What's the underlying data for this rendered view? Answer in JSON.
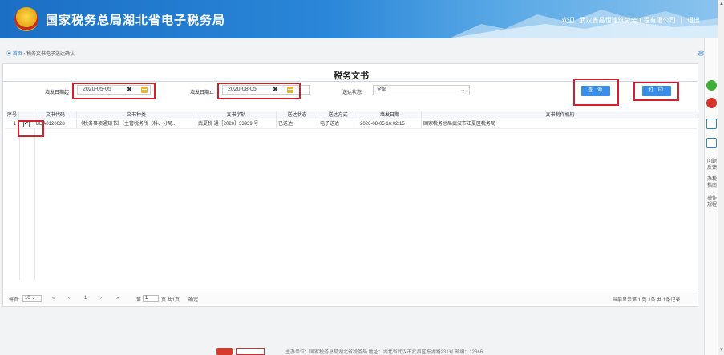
{
  "header": {
    "site_title": "国家税务总局湖北省电子税务局",
    "welcome": "欢迎",
    "user": "武汉鑫昌恒建筑劳务工程有限公司",
    "separator": "|",
    "logout": "退出"
  },
  "breadcrumb": {
    "home": "首页",
    "sep": "›",
    "current": "税务文书电子送达确认"
  },
  "back": "返回",
  "panel": {
    "title": "税务文书"
  },
  "filters": {
    "start_label": "填发日期起",
    "start_value": "2020-05-05",
    "end_label": "填发日期止",
    "end_value": "2020-08-05",
    "status_label": "送达状态:",
    "status_value": "全部",
    "clear": "✖",
    "query_button": "查 询",
    "print_button": "打 印"
  },
  "table": {
    "columns": [
      "序号",
      "文书代码",
      "文书种类",
      "文书字轨",
      "送达状态",
      "送达方式",
      "填发日期",
      "文书制作机构"
    ],
    "rows": [
      {
        "index": "1",
        "checked": "✔",
        "code": "BDA0120028",
        "kind": "《税务事项通知书》（主管税务所（科、分局...",
        "track": "武夏税 通［2020］33939 号",
        "status": "已送达",
        "method": "电子送达",
        "date": "2020-08-05 16:02:15",
        "org": "国家税务总局武汉市江夏区税务局"
      }
    ]
  },
  "pager": {
    "per_page_label": "每页:",
    "per_page_value": "10",
    "first": "«",
    "prev": "‹",
    "page_num": "1",
    "next": "›",
    "last": "»",
    "page_prefix": "第",
    "page_input": "1",
    "page_suffix": "页 共1页",
    "confirm": "确定",
    "summary": "当前显示第 1 到 1条 共 1条记录"
  },
  "rail": {
    "items": [
      "问题反馈",
      "办税指南",
      "操作规程"
    ]
  },
  "footer": {
    "text": "主办单位：国家税务总局湖北省税务局  地址：湖北省武汉市武昌区东湖路231号  邮编：12366"
  },
  "colors": {
    "header_blue": "#1b6fc4",
    "primary_button": "#3a8ee6",
    "highlight_red": "#d0202a"
  }
}
